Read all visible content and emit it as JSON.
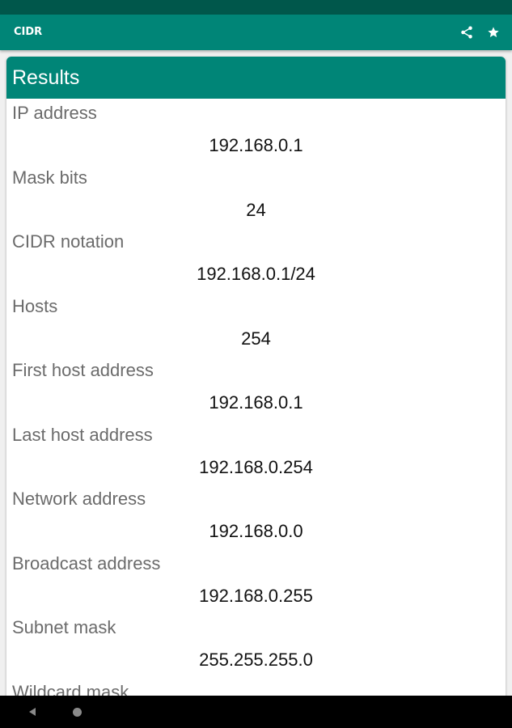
{
  "app_bar": {
    "title": "CIDR",
    "actions": [
      {
        "icon": "share-icon"
      },
      {
        "icon": "star-icon"
      }
    ]
  },
  "card": {
    "title": "Results"
  },
  "results": [
    {
      "label": "IP address",
      "value": "192.168.0.1"
    },
    {
      "label": "Mask bits",
      "value": "24"
    },
    {
      "label": "CIDR notation",
      "value": "192.168.0.1/24"
    },
    {
      "label": "Hosts",
      "value": "254"
    },
    {
      "label": "First host address",
      "value": "192.168.0.1"
    },
    {
      "label": "Last host address",
      "value": "192.168.0.254"
    },
    {
      "label": "Network address",
      "value": "192.168.0.0"
    },
    {
      "label": "Broadcast address",
      "value": "192.168.0.255"
    },
    {
      "label": "Subnet mask",
      "value": "255.255.255.0"
    },
    {
      "label": "Wildcard mask",
      "value": ""
    }
  ],
  "colors": {
    "primary": "#008577",
    "primary_dark": "#00574b",
    "label_text": "#6b6b6b",
    "value_text": "#111111"
  },
  "nav_bar": {
    "buttons": [
      {
        "icon": "back-icon"
      },
      {
        "icon": "home-icon"
      }
    ]
  }
}
